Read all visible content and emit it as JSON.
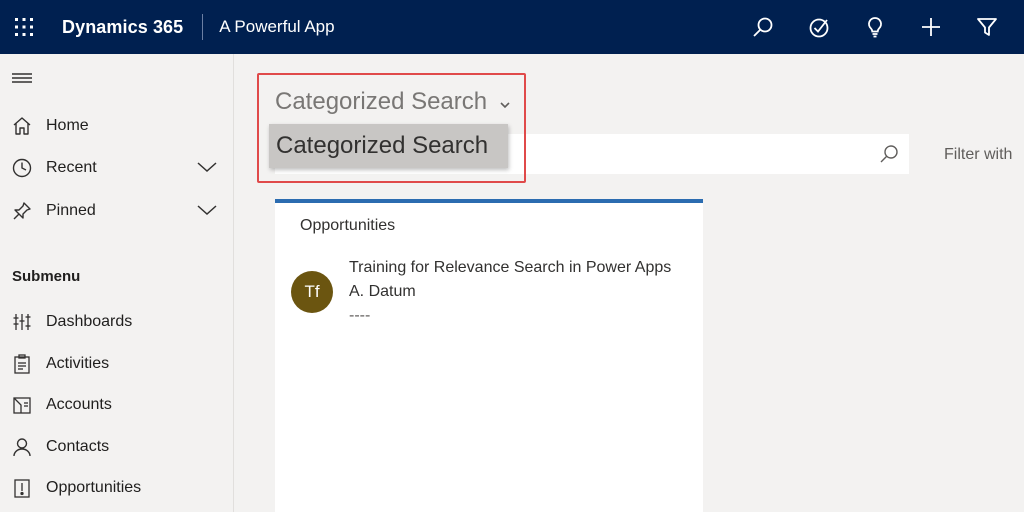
{
  "topbar": {
    "brand": "Dynamics 365",
    "app_name": "A Powerful App",
    "icons": [
      "search-icon",
      "task-icon",
      "lightbulb-icon",
      "plus-icon",
      "filter-icon"
    ],
    "background": "#002050"
  },
  "sidebar": {
    "items": [
      {
        "label": "Home",
        "icon": "home-icon"
      },
      {
        "label": "Recent",
        "icon": "clock-icon",
        "expandable": true
      },
      {
        "label": "Pinned",
        "icon": "pin-icon",
        "expandable": true
      }
    ],
    "submenu_title": "Submenu",
    "submenu_items": [
      {
        "label": "Dashboards",
        "icon": "dashboard-icon"
      },
      {
        "label": "Activities",
        "icon": "activities-icon"
      },
      {
        "label": "Accounts",
        "icon": "accounts-icon"
      },
      {
        "label": "Contacts",
        "icon": "contact-icon"
      },
      {
        "label": "Opportunities",
        "icon": "opportunity-icon"
      }
    ]
  },
  "main": {
    "category_select": {
      "selected": "Categorized Search"
    },
    "dropdown_options": [
      "Categorized Search"
    ],
    "filter_label": "Filter with",
    "results_card": {
      "title": "Opportunities",
      "accent": "#2b6cb0",
      "items": [
        {
          "initials": "Tf",
          "avatar_color": "#6b5510",
          "title": "Training for Relevance Search in Power Apps",
          "subtitle": "A. Datum",
          "extra": "----"
        }
      ]
    },
    "highlight_color": "#e04a4a"
  }
}
